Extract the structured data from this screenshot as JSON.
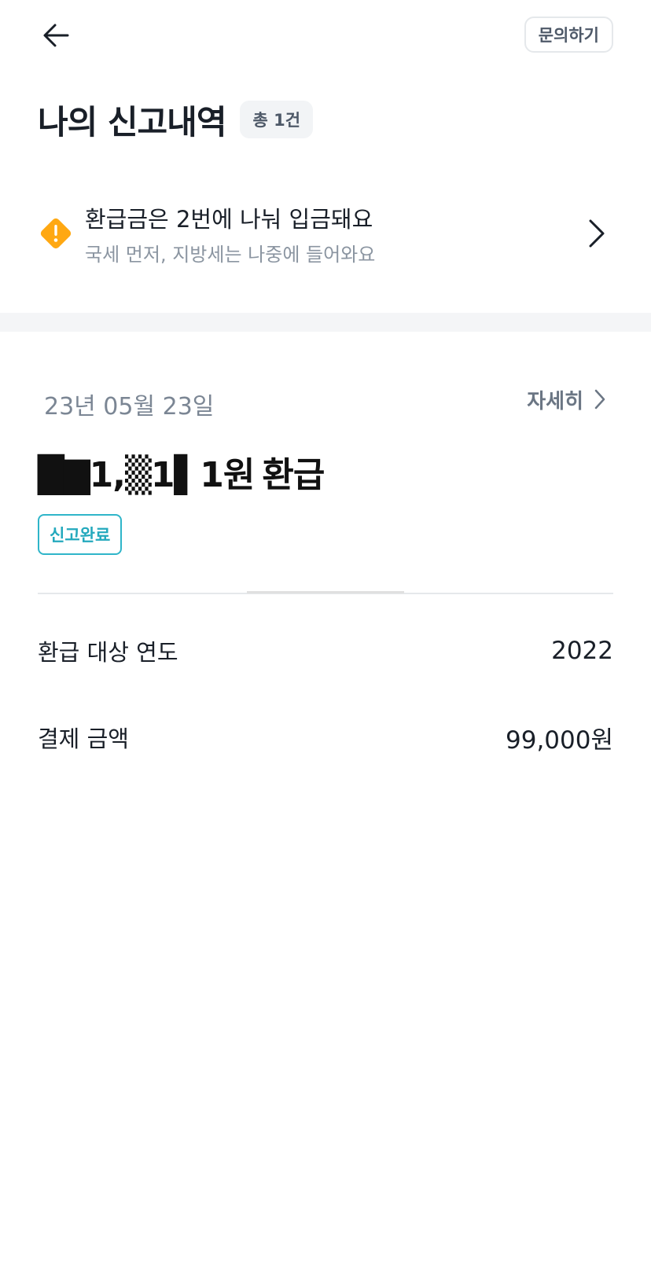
{
  "header": {
    "inquiry_label": "문의하기"
  },
  "title": {
    "text": "나의 신고내역",
    "count_badge": "총 1건"
  },
  "notice": {
    "title": "환급금은 2번에 나눠 입금돼요",
    "subtitle": "국세 먼저, 지방세는 나중에 들어와요",
    "icon": "warning-diamond-icon",
    "icon_color": "#ffa812"
  },
  "record": {
    "date": "23년 05월 23일",
    "detail_label": "자세히",
    "amount": "█▇1,▒1▌1원",
    "amount_suffix": "환급",
    "status": "신고완료",
    "status_color": "#24a9bd",
    "rows": [
      {
        "label": "환급 대상 연도",
        "value": "2022"
      },
      {
        "label": "결제 금액",
        "value": "99,000원"
      }
    ]
  }
}
